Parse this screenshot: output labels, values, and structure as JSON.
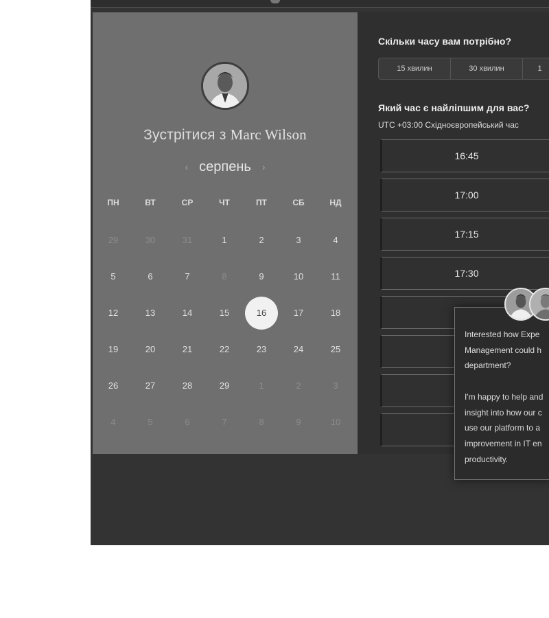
{
  "host": {
    "meet_prefix": "Зустрітися з",
    "name": "Marc Wilson"
  },
  "calendar": {
    "month": "серпень",
    "prev_icon": "chevron-left-icon",
    "next_icon": "chevron-right-icon",
    "weekdays": [
      "ПН",
      "ВТ",
      "СР",
      "ЧТ",
      "ПТ",
      "СБ",
      "НД"
    ],
    "weeks": [
      [
        "29",
        "30",
        "31",
        "1",
        "2",
        "3",
        "4"
      ],
      [
        "5",
        "6",
        "7",
        "8",
        "9",
        "10",
        "11"
      ],
      [
        "12",
        "13",
        "14",
        "15",
        "16",
        "17",
        "18"
      ],
      [
        "19",
        "20",
        "21",
        "22",
        "23",
        "24",
        "25"
      ],
      [
        "26",
        "27",
        "28",
        "29",
        "1",
        "2",
        "3"
      ],
      [
        "4",
        "5",
        "6",
        "7",
        "8",
        "9",
        "10"
      ]
    ],
    "selected_day": "16"
  },
  "booking": {
    "duration_question": "Скільки часу вам потрібно?",
    "durations": [
      "15 хвилин",
      "30 хвилин",
      "1"
    ],
    "time_question": "Який час є найліпшим для вас?",
    "timezone": "UTC +03:00 Східноєвропейський час",
    "slots": [
      "16:45",
      "17:00",
      "17:15",
      "17:30"
    ]
  },
  "chat": {
    "line1": "Interested how Expe",
    "line2": "Management could h",
    "line3": "department?",
    "line4": "I'm happy to help and",
    "line5": "insight into how our c",
    "line6": "use our platform to a",
    "line7": "improvement in IT en",
    "line8": "productivity."
  },
  "colors": {
    "left_panel": "#6f6f6f",
    "right_panel": "#2f2f2f",
    "selected_day_bg": "#f1f1f1"
  }
}
